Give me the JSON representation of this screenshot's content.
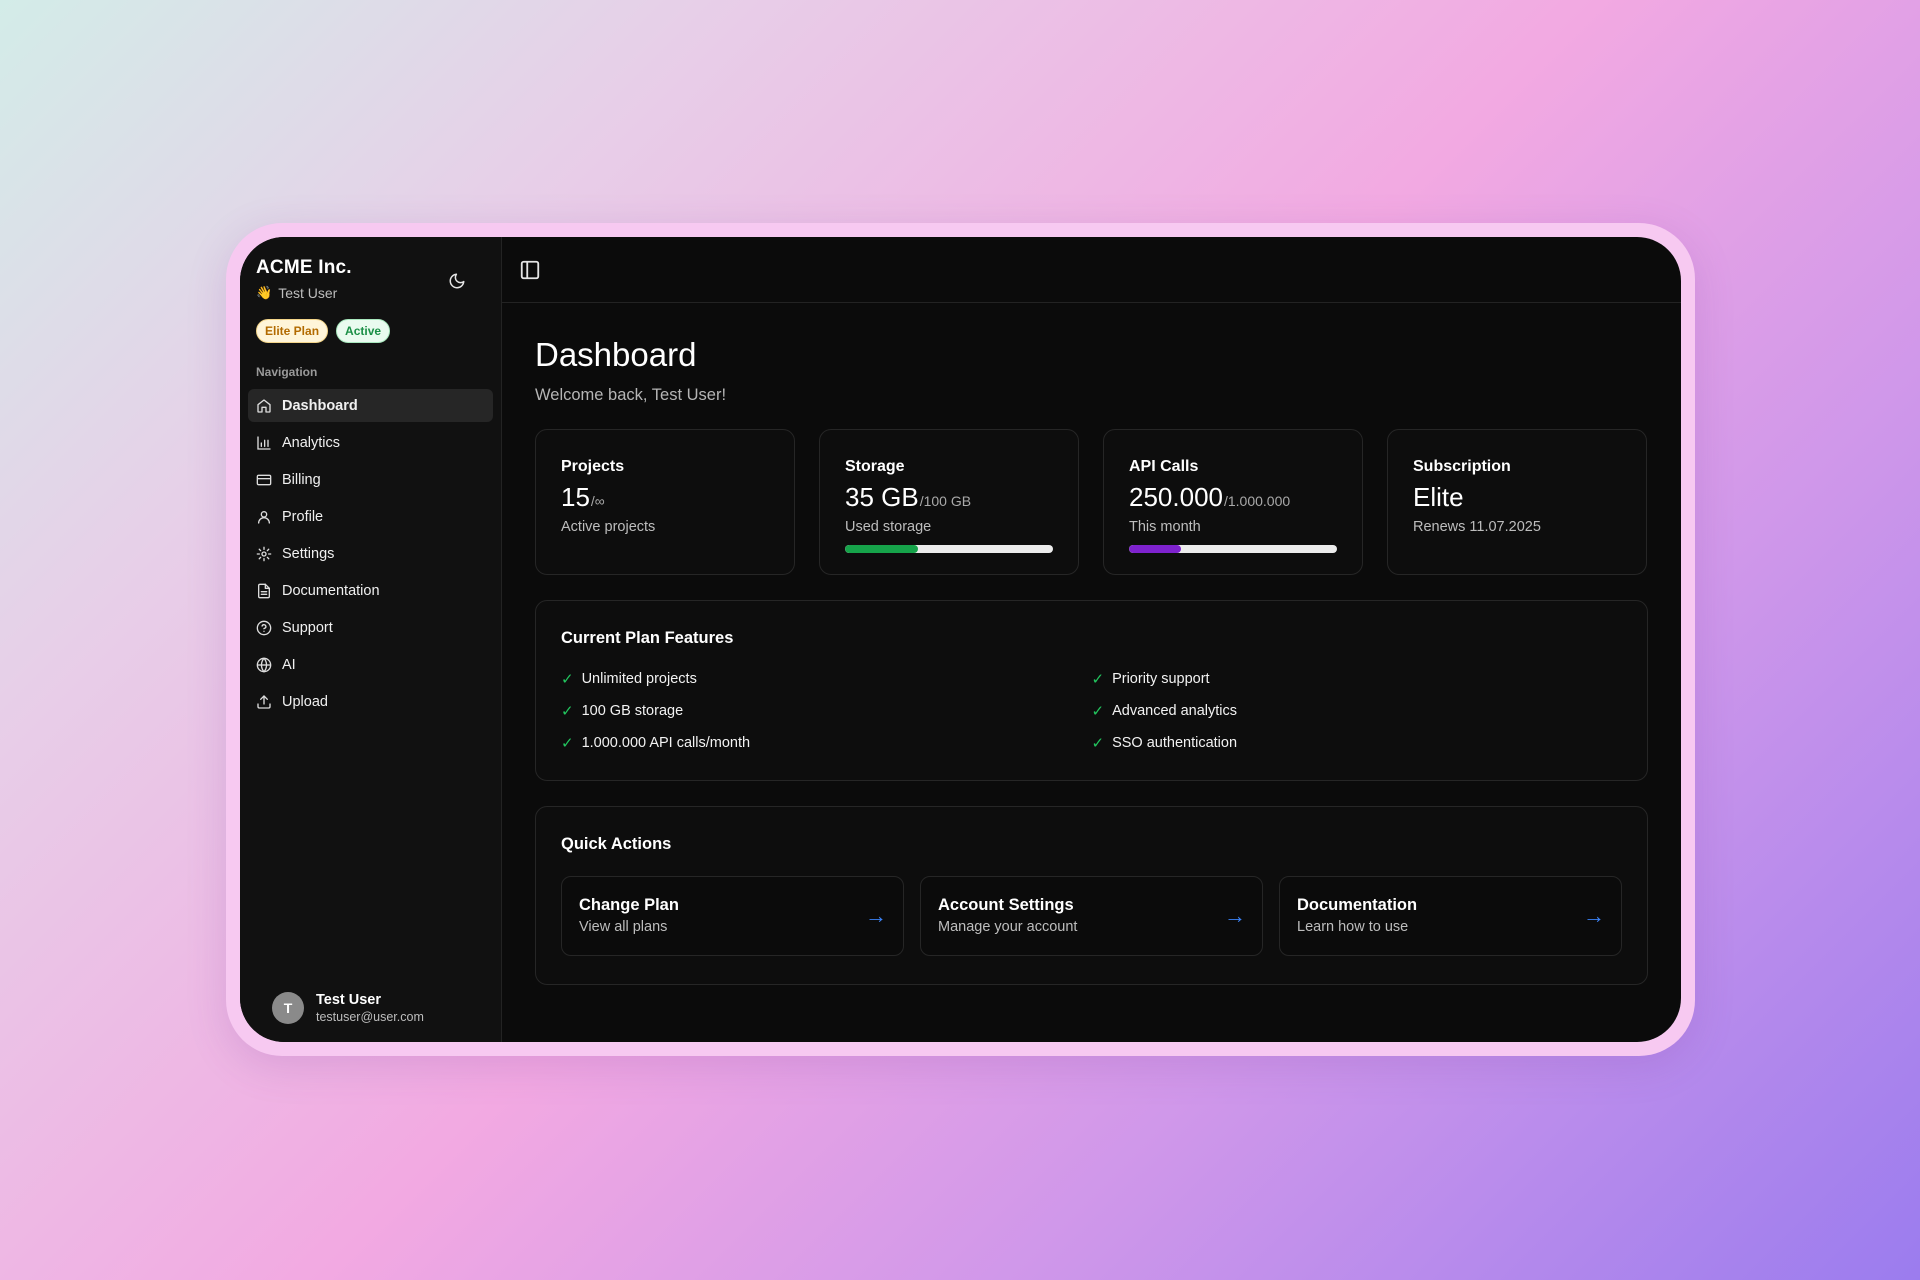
{
  "brand": {
    "name": "ACME Inc.",
    "user": "Test User",
    "wave": "👋"
  },
  "badges": {
    "plan": "Elite Plan",
    "status": "Active"
  },
  "nav": {
    "heading": "Navigation",
    "items": [
      {
        "label": "Dashboard",
        "icon": "home-icon",
        "active": true
      },
      {
        "label": "Analytics",
        "icon": "bar-chart-icon"
      },
      {
        "label": "Billing",
        "icon": "credit-card-icon"
      },
      {
        "label": "Profile",
        "icon": "user-icon"
      },
      {
        "label": "Settings",
        "icon": "gear-icon"
      },
      {
        "label": "Documentation",
        "icon": "file-text-icon"
      },
      {
        "label": "Support",
        "icon": "help-circle-icon"
      },
      {
        "label": "AI",
        "icon": "globe-icon"
      },
      {
        "label": "Upload",
        "icon": "upload-icon"
      }
    ]
  },
  "footer_user": {
    "initial": "T",
    "name": "Test User",
    "email": "testuser@user.com"
  },
  "page": {
    "title": "Dashboard",
    "subtitle": "Welcome back, Test User!"
  },
  "stats": [
    {
      "label": "Projects",
      "value": "15",
      "unit": "/∞",
      "desc": "Active projects"
    },
    {
      "label": "Storage",
      "value": "35 GB",
      "unit": "/100 GB",
      "desc": "Used storage",
      "progress": 0.35,
      "color": "#16a34a"
    },
    {
      "label": "API Calls",
      "value": "250.000",
      "unit": "/1.000.000",
      "desc": "This month",
      "progress": 0.25,
      "color": "#7e22ce"
    },
    {
      "label": "Subscription",
      "value": "Elite",
      "unit": "",
      "desc": "Renews 11.07.2025"
    }
  ],
  "features": {
    "title": "Current Plan Features",
    "check": "✓",
    "items": [
      "Unlimited projects",
      "Priority support",
      "100 GB storage",
      "Advanced analytics",
      "1.000.000 API calls/month",
      "SSO authentication"
    ]
  },
  "quick_actions": {
    "title": "Quick Actions",
    "arrow": "→",
    "items": [
      {
        "title": "Change Plan",
        "sub": "View all plans"
      },
      {
        "title": "Account Settings",
        "sub": "Manage your account"
      },
      {
        "title": "Documentation",
        "sub": "Learn how to use"
      }
    ]
  },
  "colors": {
    "accent_blue": "#3b82f6",
    "check_green": "#22c55e",
    "sidebar_bg": "#111111",
    "main_bg": "#0b0b0b"
  }
}
